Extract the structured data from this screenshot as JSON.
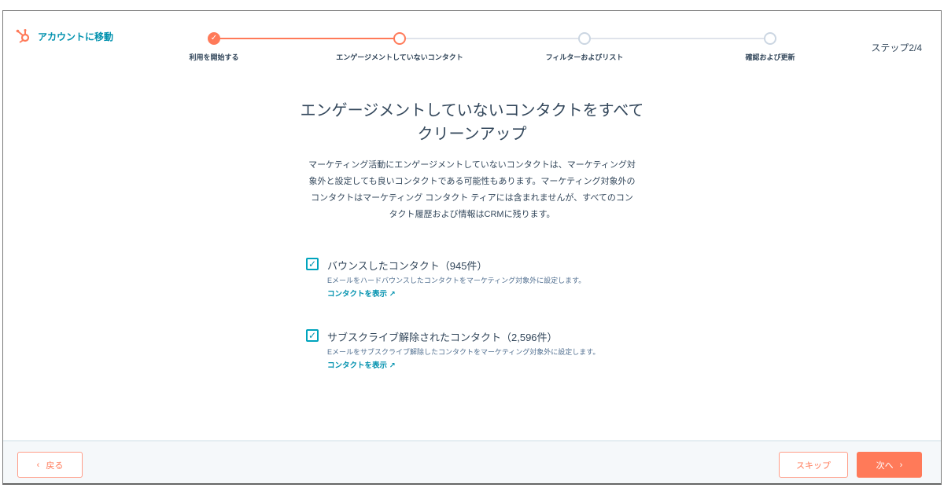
{
  "header": {
    "back_link": "アカウントに移動",
    "step_count": "ステップ2/4"
  },
  "steps": [
    {
      "label": "利用を開始する",
      "state": "done"
    },
    {
      "label": "エンゲージメントしていないコンタクト",
      "state": "current"
    },
    {
      "label": "フィルターおよびリスト",
      "state": "todo"
    },
    {
      "label": "確認および更新",
      "state": "todo"
    }
  ],
  "main": {
    "title_line1": "エンゲージメントしていないコンタクトをすべて",
    "title_line2": "クリーンアップ",
    "desc_line1": "マーケティング活動にエンゲージメントしていないコンタクトは、マーケティング対",
    "desc_line2": "象外と設定しても良いコンタクトである可能性もあります。マーケティング対象外の",
    "desc_line3": "コンタクトはマーケティング コンタクト ティアには含まれませんが、すべてのコン",
    "desc_line4": "タクト履歴および情報はCRMに残ります。",
    "options": [
      {
        "title": "バウンスしたコンタクト（945件）",
        "sub": "Eメールをハードバウンスしたコンタクトをマーケティング対象外に設定します。",
        "link": "コンタクトを表示",
        "checked": true
      },
      {
        "title": "サブスクライブ解除されたコンタクト（2,596件）",
        "sub": "Eメールをサブスクライブ解除したコンタクトをマーケティング対象外に設定します。",
        "link": "コンタクトを表示",
        "checked": true
      }
    ]
  },
  "footer": {
    "back": "戻る",
    "skip": "スキップ",
    "next": "次へ"
  },
  "colors": {
    "accent": "#ff7a59",
    "link": "#0091ae"
  }
}
